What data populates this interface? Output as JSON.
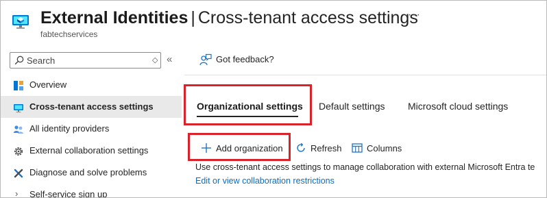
{
  "header": {
    "title_bold": "External Identities",
    "title_sep": "|",
    "title_rest": "Cross-tenant access settings",
    "more": "···",
    "tenant": "fabtechservices"
  },
  "sidebar": {
    "search": {
      "placeholder": "Search"
    },
    "sort_icon": "◇",
    "collapse": "«",
    "items": [
      {
        "label": "Overview",
        "icon": "overview-icon"
      },
      {
        "label": "Cross-tenant access settings",
        "icon": "cross-tenant-icon",
        "active": true
      },
      {
        "label": "All identity providers",
        "icon": "identity-providers-icon"
      },
      {
        "label": "External collaboration settings",
        "icon": "gear-icon"
      },
      {
        "label": "Diagnose and solve problems",
        "icon": "wrench-icon"
      },
      {
        "label": "Self-service sign up",
        "icon": "chevron-right-icon"
      }
    ]
  },
  "main": {
    "feedback": "Got feedback?",
    "tabs": [
      {
        "label": "Organizational settings",
        "active": true
      },
      {
        "label": "Default settings"
      },
      {
        "label": "Microsoft cloud settings"
      }
    ],
    "commands": {
      "add": "Add organization",
      "refresh": "Refresh",
      "columns": "Columns"
    },
    "description": "Use cross-tenant access settings to manage collaboration with external Microsoft Entra te",
    "link": "Edit or view collaboration restrictions"
  },
  "colors": {
    "accent": "#0f6cbd",
    "highlight_box": "#d8232a",
    "active_nav_bg": "#e9e9e9"
  }
}
